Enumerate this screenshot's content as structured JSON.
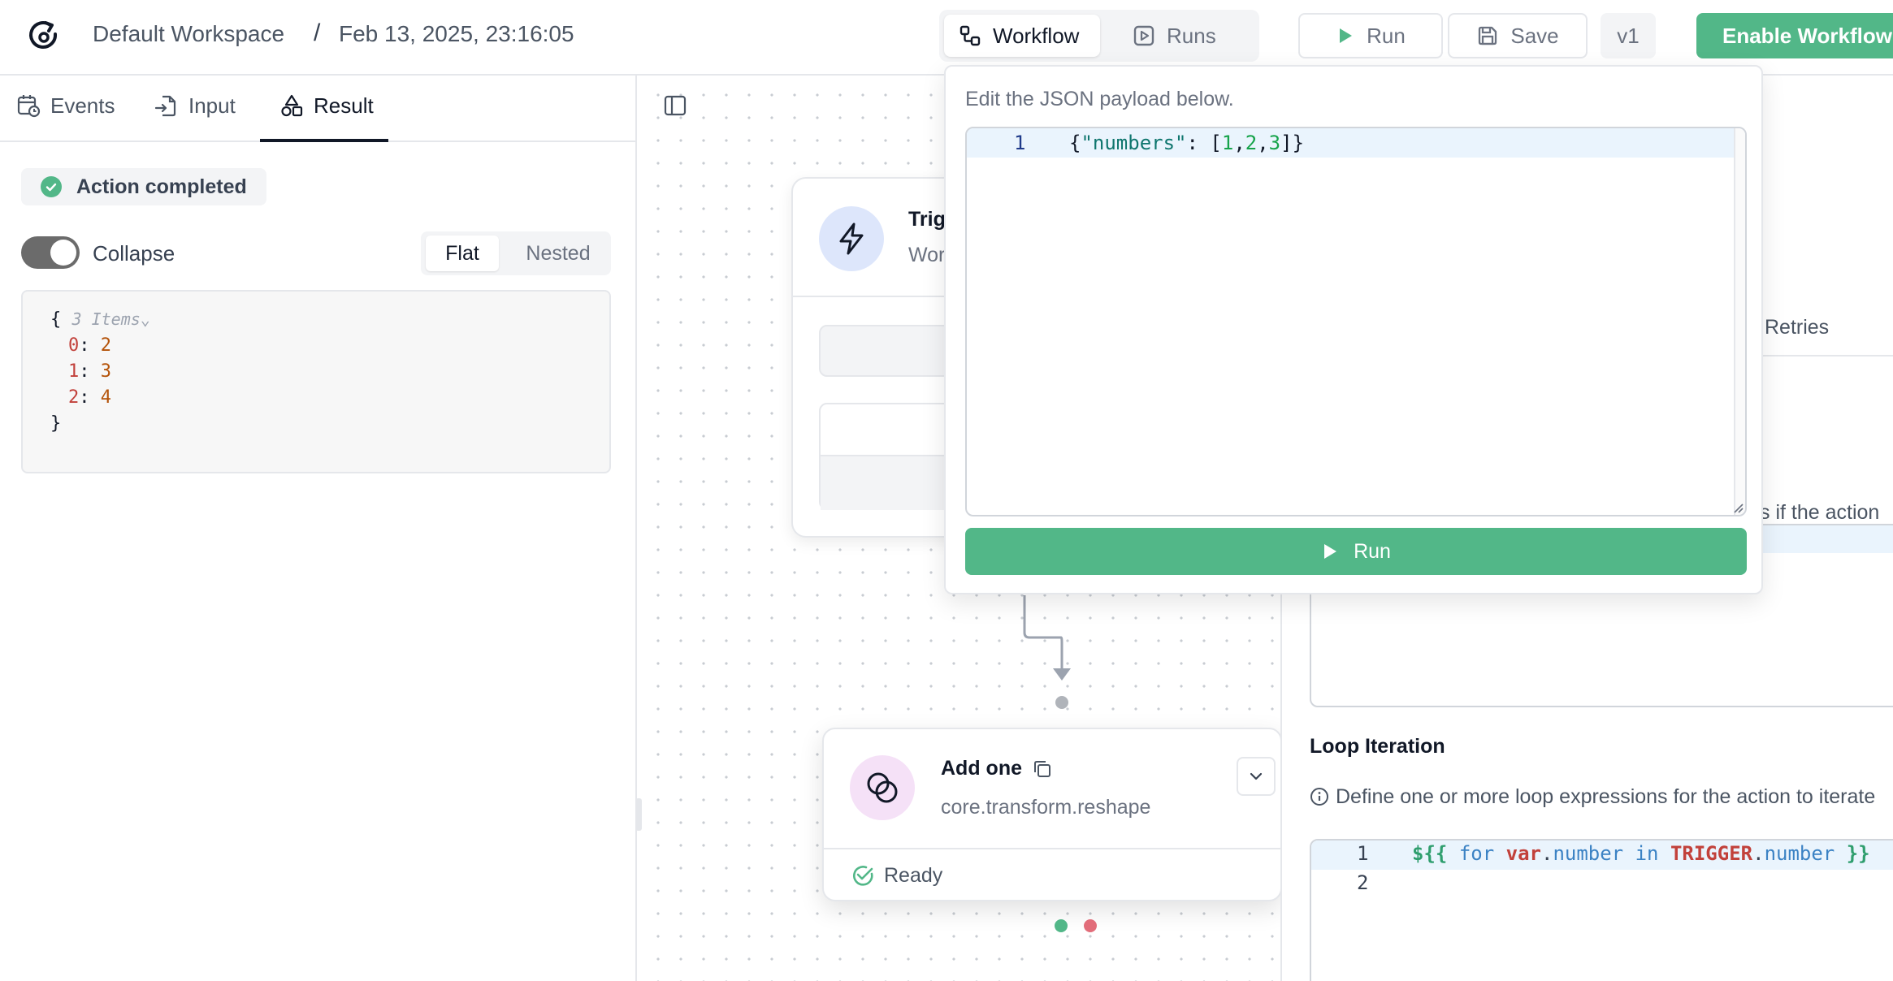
{
  "header": {
    "workspace": "Default Workspace",
    "separator": "/",
    "timestamp": "Feb 13, 2025, 23:16:05",
    "view_tabs": {
      "workflow": "Workflow",
      "runs": "Runs"
    },
    "run_label": "Run",
    "save_label": "Save",
    "version": "v1",
    "enable_label": "Enable Workflow"
  },
  "left_panel": {
    "tabs": {
      "events": "Events",
      "input": "Input",
      "result": "Result"
    },
    "status_badge": "Action completed",
    "collapse_label": "Collapse",
    "view_mode": {
      "flat": "Flat",
      "nested": "Nested"
    },
    "result_json": {
      "open_brace": "{",
      "items_meta": "3 Items",
      "rows": [
        {
          "key": "0",
          "value": "2"
        },
        {
          "key": "1",
          "value": "3"
        },
        {
          "key": "2",
          "value": "4"
        }
      ],
      "close_brace": "}"
    }
  },
  "canvas": {
    "trigger_node": {
      "title": "Trig",
      "subtitle": "Wor"
    },
    "action_node": {
      "title": "Add one",
      "subtitle": "core.transform.reshape",
      "status": "Ready"
    }
  },
  "right_panel": {
    "retries_tab": "Retries",
    "partial_description": "s if the action",
    "loop_title": "Loop Iteration",
    "loop_description": "Define one or more loop expressions for the action to iterate",
    "loop_editor": {
      "line_numbers": [
        "1",
        "2"
      ],
      "tokens": {
        "open": "${{",
        "kw_for": "for",
        "var": "var",
        "dot1": ".",
        "number": "number",
        "kw_in": "in",
        "trigger": "TRIGGER",
        "dot2": ".",
        "number2": "number",
        "close": "}}"
      }
    }
  },
  "popover": {
    "description": "Edit the JSON payload below.",
    "editor": {
      "line_number": "1",
      "tokens": {
        "open": "{",
        "key": "\"numbers\"",
        "colon": ": [",
        "n1": "1",
        "c1": ",",
        "n2": "2",
        "c2": ",",
        "n3": "3",
        "close": "]}"
      }
    },
    "run_label": "Run"
  },
  "colors": {
    "accent_green": "#52b788",
    "json_key": "#c2413b",
    "json_value": "#b45309",
    "code_blue": "#3b82c4",
    "code_red": "#c2413b",
    "error_dot": "#e26d7a"
  }
}
